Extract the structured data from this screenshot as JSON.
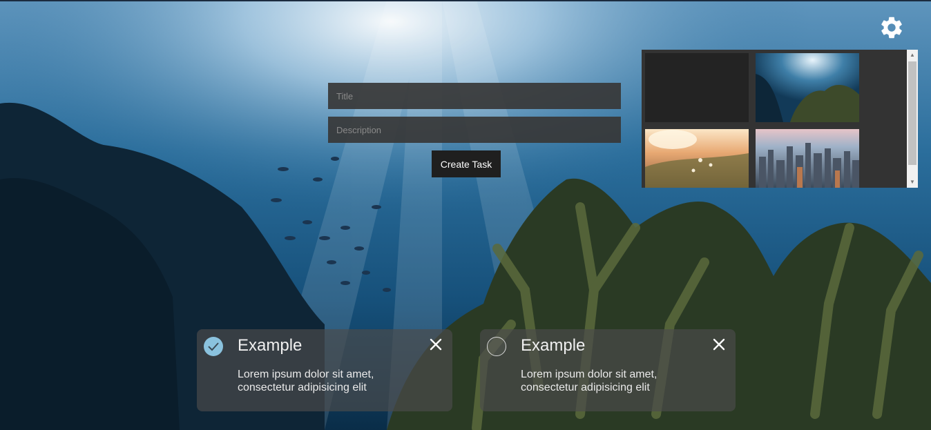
{
  "form": {
    "title_placeholder": "Title",
    "description_placeholder": "Description",
    "create_label": "Create Task"
  },
  "settings": {
    "icon": "gear-icon"
  },
  "background_picker": {
    "thumbnails": [
      "blank",
      "underwater-coral",
      "flower-field-sunset",
      "city-skyline"
    ]
  },
  "tasks": [
    {
      "title": "Example",
      "description": "Lorem ipsum dolor sit amet, consectetur adipisicing elit",
      "completed": true
    },
    {
      "title": "Example",
      "description": "Lorem ipsum dolor sit amet, consectetur adipisicing elit",
      "completed": false
    }
  ],
  "colors": {
    "card_bg": "#4b4b4b",
    "check_done": "#8ac2de",
    "button_bg": "#1f1f1f",
    "picker_bg": "#333333"
  }
}
